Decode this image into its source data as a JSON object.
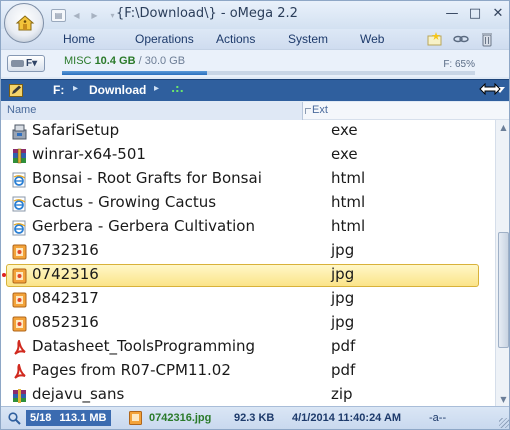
{
  "window": {
    "title": "{F:\\Download\\} - oMega 2.2",
    "controls": {
      "minimize": "—",
      "maximize": "□",
      "close": "✕"
    }
  },
  "menu": {
    "items": [
      "Home",
      "Operations",
      "Actions",
      "System",
      "Web"
    ]
  },
  "drive": {
    "button_label": "F",
    "volume_name": "MISC",
    "used": "10.4 GB",
    "separator": "/",
    "total": "30.0 GB",
    "free": "F: 65%",
    "usage_fraction": 0.35
  },
  "path": {
    "segments": [
      "F:",
      "Download"
    ],
    "indicator": ".:."
  },
  "columns": {
    "name": "Name",
    "ext": "Ext"
  },
  "files": [
    {
      "name": "SafariSetup",
      "ext": "exe",
      "icon": "installer-icon"
    },
    {
      "name": "winrar-x64-501",
      "ext": "exe",
      "icon": "winrar-icon"
    },
    {
      "name": "Bonsai - Root Grafts for Bonsai",
      "ext": "html",
      "icon": "ie-html-icon"
    },
    {
      "name": "Cactus - Growing Cactus",
      "ext": "html",
      "icon": "ie-html-icon"
    },
    {
      "name": "Gerbera - Gerbera Cultivation",
      "ext": "html",
      "icon": "ie-html-icon"
    },
    {
      "name": "0732316",
      "ext": "jpg",
      "icon": "image-icon"
    },
    {
      "name": "0742316",
      "ext": "jpg",
      "icon": "image-icon",
      "selected": true
    },
    {
      "name": "0842317",
      "ext": "jpg",
      "icon": "image-icon"
    },
    {
      "name": "0852316",
      "ext": "jpg",
      "icon": "image-icon"
    },
    {
      "name": "Datasheet_ToolsProgramming",
      "ext": "pdf",
      "icon": "pdf-icon"
    },
    {
      "name": "Pages from R07-CPM11.02",
      "ext": "pdf",
      "icon": "pdf-icon"
    },
    {
      "name": "dejavu_sans",
      "ext": "zip",
      "icon": "zip-archive-icon"
    }
  ],
  "status": {
    "selection": "5/18",
    "total_size": "113.1 MB",
    "file_name": "0742316.jpg",
    "file_size": "92.3 KB",
    "date": "4/1/2014 11:40:24 AM",
    "attributes": "-a--"
  },
  "colors": {
    "path_bar": "#2f5f9e",
    "selection_fill": "#fbe489",
    "selection_border": "#d8b23a",
    "accent_green": "#2a7a2a"
  }
}
